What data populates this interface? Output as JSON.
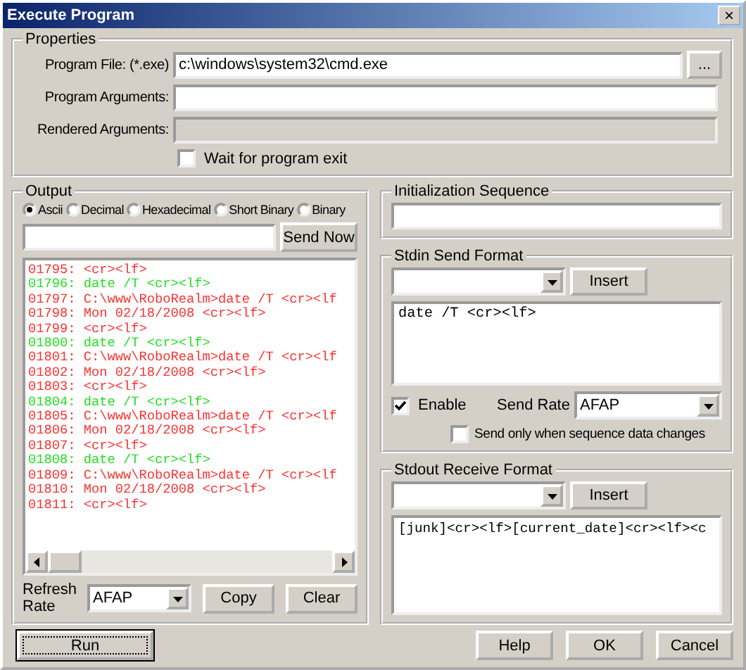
{
  "window": {
    "title": "Execute Program",
    "close": "×"
  },
  "properties": {
    "label": "Properties",
    "fields": [
      {
        "label": "Program File: (*.exe)",
        "value": "c:\\windows\\system32\\cmd.exe",
        "disabled": false
      },
      {
        "label": "Program Arguments:",
        "disabled": false
      },
      {
        "label": "Rendered Arguments:",
        "disabled": true
      }
    ],
    "browse_button": "...",
    "wait_checkbox": {
      "label": "Wait for program exit",
      "checked": false
    }
  },
  "output": {
    "label": "Output",
    "formats": [
      {
        "label": "Ascii",
        "selected": true
      },
      {
        "label": "Decimal",
        "selected": false
      },
      {
        "label": "Hexadecimal",
        "selected": false
      },
      {
        "label": "Short Binary",
        "selected": false
      },
      {
        "label": "Binary",
        "selected": false
      }
    ],
    "send_button": "Send Now",
    "lines": [
      {
        "text": "01795: <cr><lf>",
        "kind": "received"
      },
      {
        "text": "01796: date /T <cr><lf>",
        "kind": "sent"
      },
      {
        "text": "01797: C:\\www\\RoboRealm>date /T <cr><lf",
        "kind": "received"
      },
      {
        "text": "01798: Mon 02/18/2008 <cr><lf>",
        "kind": "received"
      },
      {
        "text": "01799: <cr><lf>",
        "kind": "received"
      },
      {
        "text": "01800: date /T <cr><lf>",
        "kind": "sent"
      },
      {
        "text": "01801: C:\\www\\RoboRealm>date /T <cr><lf",
        "kind": "received"
      },
      {
        "text": "01802: Mon 02/18/2008 <cr><lf>",
        "kind": "received"
      },
      {
        "text": "01803: <cr><lf>",
        "kind": "received"
      },
      {
        "text": "01804: date /T <cr><lf>",
        "kind": "sent"
      },
      {
        "text": "01805: C:\\www\\RoboRealm>date /T <cr><lf",
        "kind": "received"
      },
      {
        "text": "01806: Mon 02/18/2008 <cr><lf>",
        "kind": "received"
      },
      {
        "text": "01807: <cr><lf>",
        "kind": "received"
      },
      {
        "text": "01808: date /T <cr><lf>",
        "kind": "sent"
      },
      {
        "text": "01809: C:\\www\\RoboRealm>date /T <cr><lf",
        "kind": "received"
      },
      {
        "text": "01810: Mon 02/18/2008 <cr><lf>",
        "kind": "received"
      },
      {
        "text": "01811: <cr><lf>",
        "kind": "received"
      }
    ],
    "refresh_rate": {
      "label": "Refresh Rate",
      "value": "AFAP"
    },
    "copy_button": "Copy",
    "clear_button": "Clear"
  },
  "init_sequence": {
    "label": "Initialization Sequence"
  },
  "stdin": {
    "label": "Stdin Send Format",
    "insert_button": "Insert",
    "text": "date /T <cr><lf>",
    "enable": {
      "label": "Enable",
      "checked": true
    },
    "send_rate": {
      "label": "Send Rate",
      "value": "AFAP"
    },
    "send_only": {
      "label": "Send only when sequence data changes",
      "checked": false
    }
  },
  "stdout": {
    "label": "Stdout Receive Format",
    "insert_button": "Insert",
    "text": "[junk]<cr><lf>[current_date]<cr><lf><c"
  },
  "buttons": {
    "run": "Run",
    "help": "Help",
    "ok": "OK",
    "cancel": "Cancel"
  }
}
